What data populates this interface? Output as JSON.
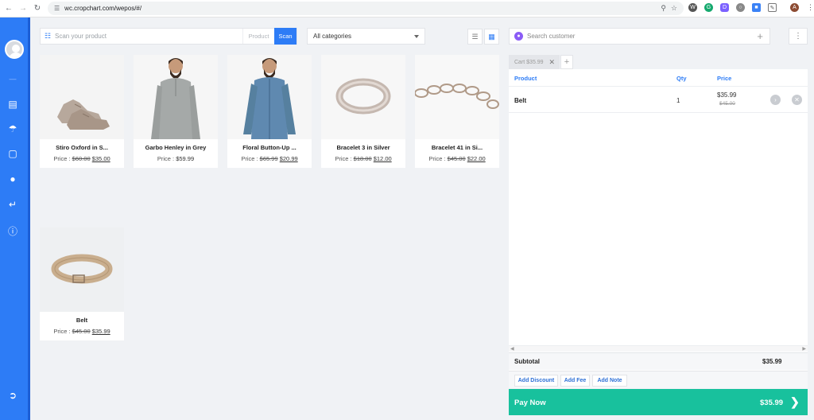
{
  "browser": {
    "url": "wc.cropchart.com/wepos/#/"
  },
  "toolbar": {
    "scan_placeholder": "Scan your product",
    "product_label": "Product",
    "scan_button": "Scan",
    "category_selected": "All categories"
  },
  "products": [
    {
      "name": "Stiro Oxford in S...",
      "price_label": "Price :",
      "old_price": "$60.00",
      "new_price": "$35.00"
    },
    {
      "name": "Garbo Henley in Grey",
      "price_label": "Price :",
      "old_price": "",
      "new_price": "$59.99"
    },
    {
      "name": "Floral Button-Up ...",
      "price_label": "Price :",
      "old_price": "$65.99",
      "new_price": "$20.99"
    },
    {
      "name": "Bracelet 3 in Silver",
      "price_label": "Price :",
      "old_price": "$18.00",
      "new_price": "$12.00"
    },
    {
      "name": "Bracelet 41 in Si...",
      "price_label": "Price :",
      "old_price": "$45.00",
      "new_price": "$22.00"
    },
    {
      "name": "Belt",
      "price_label": "Price :",
      "old_price": "$45.00",
      "new_price": "$35.99"
    }
  ],
  "customer": {
    "placeholder": "Search customer"
  },
  "cart": {
    "tab_label": "Cart $35.99",
    "columns": {
      "product": "Product",
      "qty": "Qty",
      "price": "Price"
    },
    "items": [
      {
        "name": "Belt",
        "qty": "1",
        "price": "$35.99",
        "old_price": "$45.00"
      }
    ],
    "subtotal_label": "Subtotal",
    "subtotal_value": "$35.99",
    "actions": {
      "discount": "Add Discount",
      "fee": "Add Fee",
      "note": "Add Note"
    },
    "pay_label": "Pay Now",
    "pay_amount": "$35.99"
  },
  "colors": {
    "primary": "#2d7cf6",
    "pay": "#18c19d",
    "background": "#f0f2f5"
  }
}
